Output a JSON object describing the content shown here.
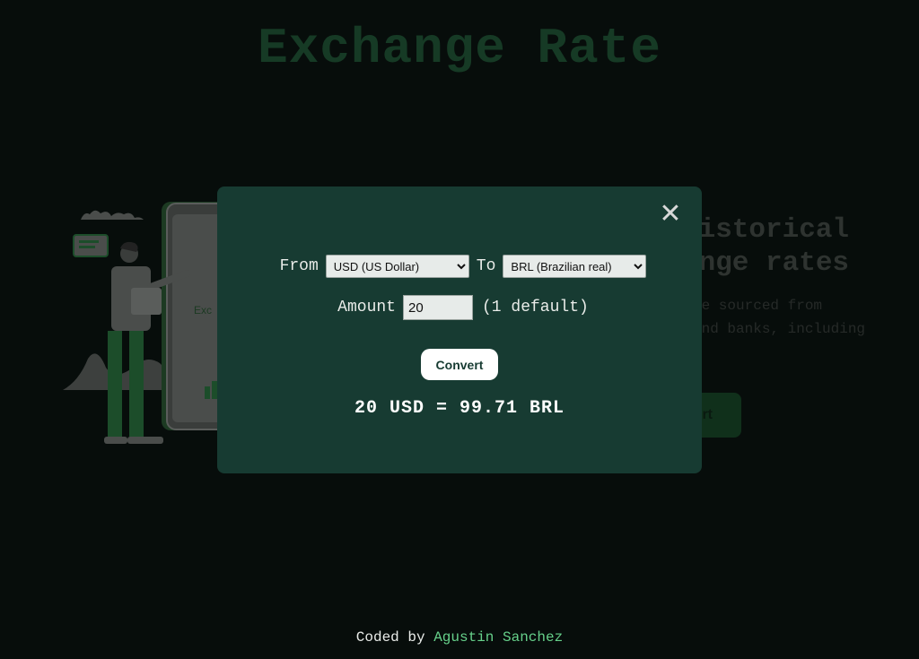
{
  "background": {
    "title": "Exchange Rate",
    "heading": "historical\nange rates",
    "text": "re sourced from\nand banks, including\n.",
    "button_label": "rt"
  },
  "modal": {
    "close_label": "✕",
    "from_label": "From",
    "from_selected": "USD (US Dollar)",
    "to_label": "To",
    "to_selected": "BRL (Brazilian real)",
    "amount_label": "Amount",
    "amount_value": "20",
    "amount_hint": "(1 default)",
    "convert_label": "Convert",
    "result": "20 USD = 99.71 BRL"
  },
  "footer": {
    "prefix": "Coded by ",
    "author": "Agustin Sanchez"
  },
  "colors": {
    "page_bg": "#070d0b",
    "modal_bg": "#173b32",
    "accent": "#66d08a",
    "title": "#163a25"
  }
}
